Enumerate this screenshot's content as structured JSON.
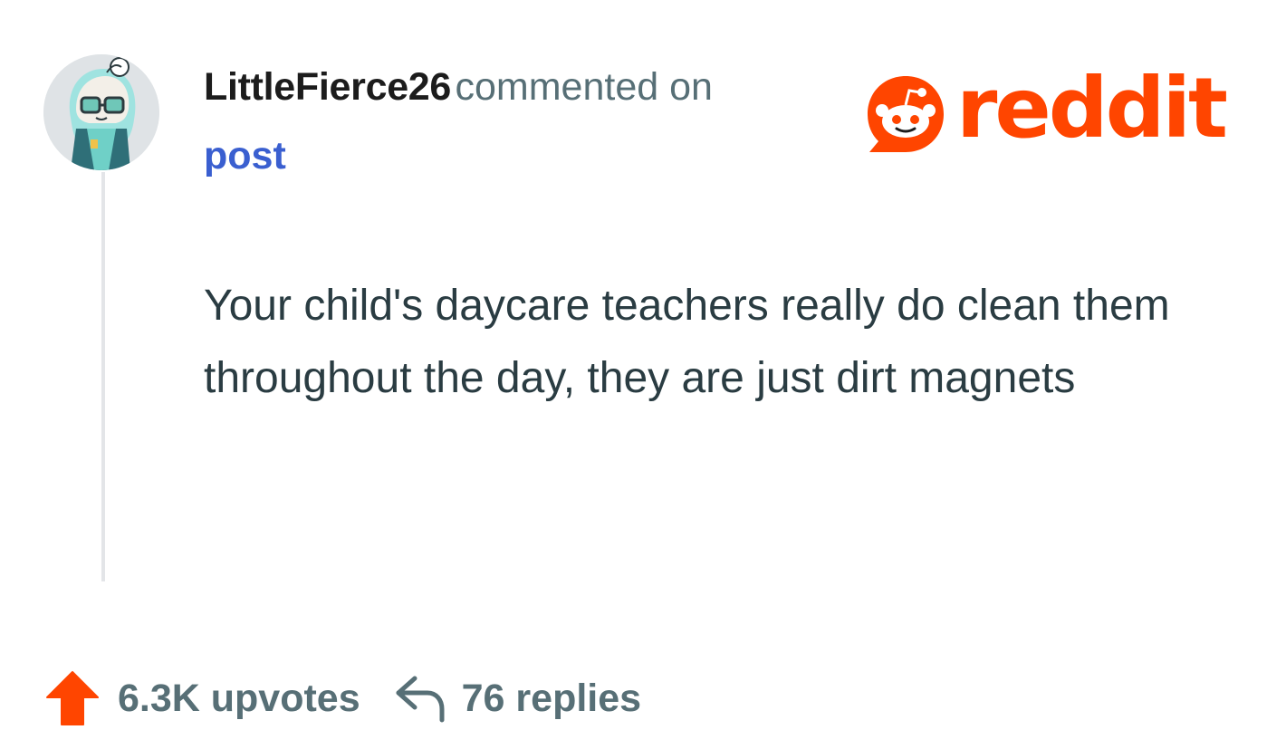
{
  "header": {
    "username": "LittleFierce26",
    "action_text": "commented on",
    "target_link": "post"
  },
  "brand": {
    "wordmark": "reddit",
    "color": "#ff4500",
    "icon": "reddit-snoo-icon"
  },
  "comment": {
    "body": "Your child's daycare teachers really do clean them throughout the day, they are just dirt magnets"
  },
  "footer": {
    "upvotes": "6.3K upvotes",
    "upvote_icon": "arrow-up-icon",
    "upvote_color": "#ff4500",
    "replies": "76 replies",
    "reply_icon": "reply-arrow-icon"
  },
  "colors": {
    "username": "#1c1c1c",
    "meta": "#576f76",
    "link": "#3a5fd0",
    "body_text": "#2a3c42",
    "thread_line": "#e3e5e8"
  }
}
